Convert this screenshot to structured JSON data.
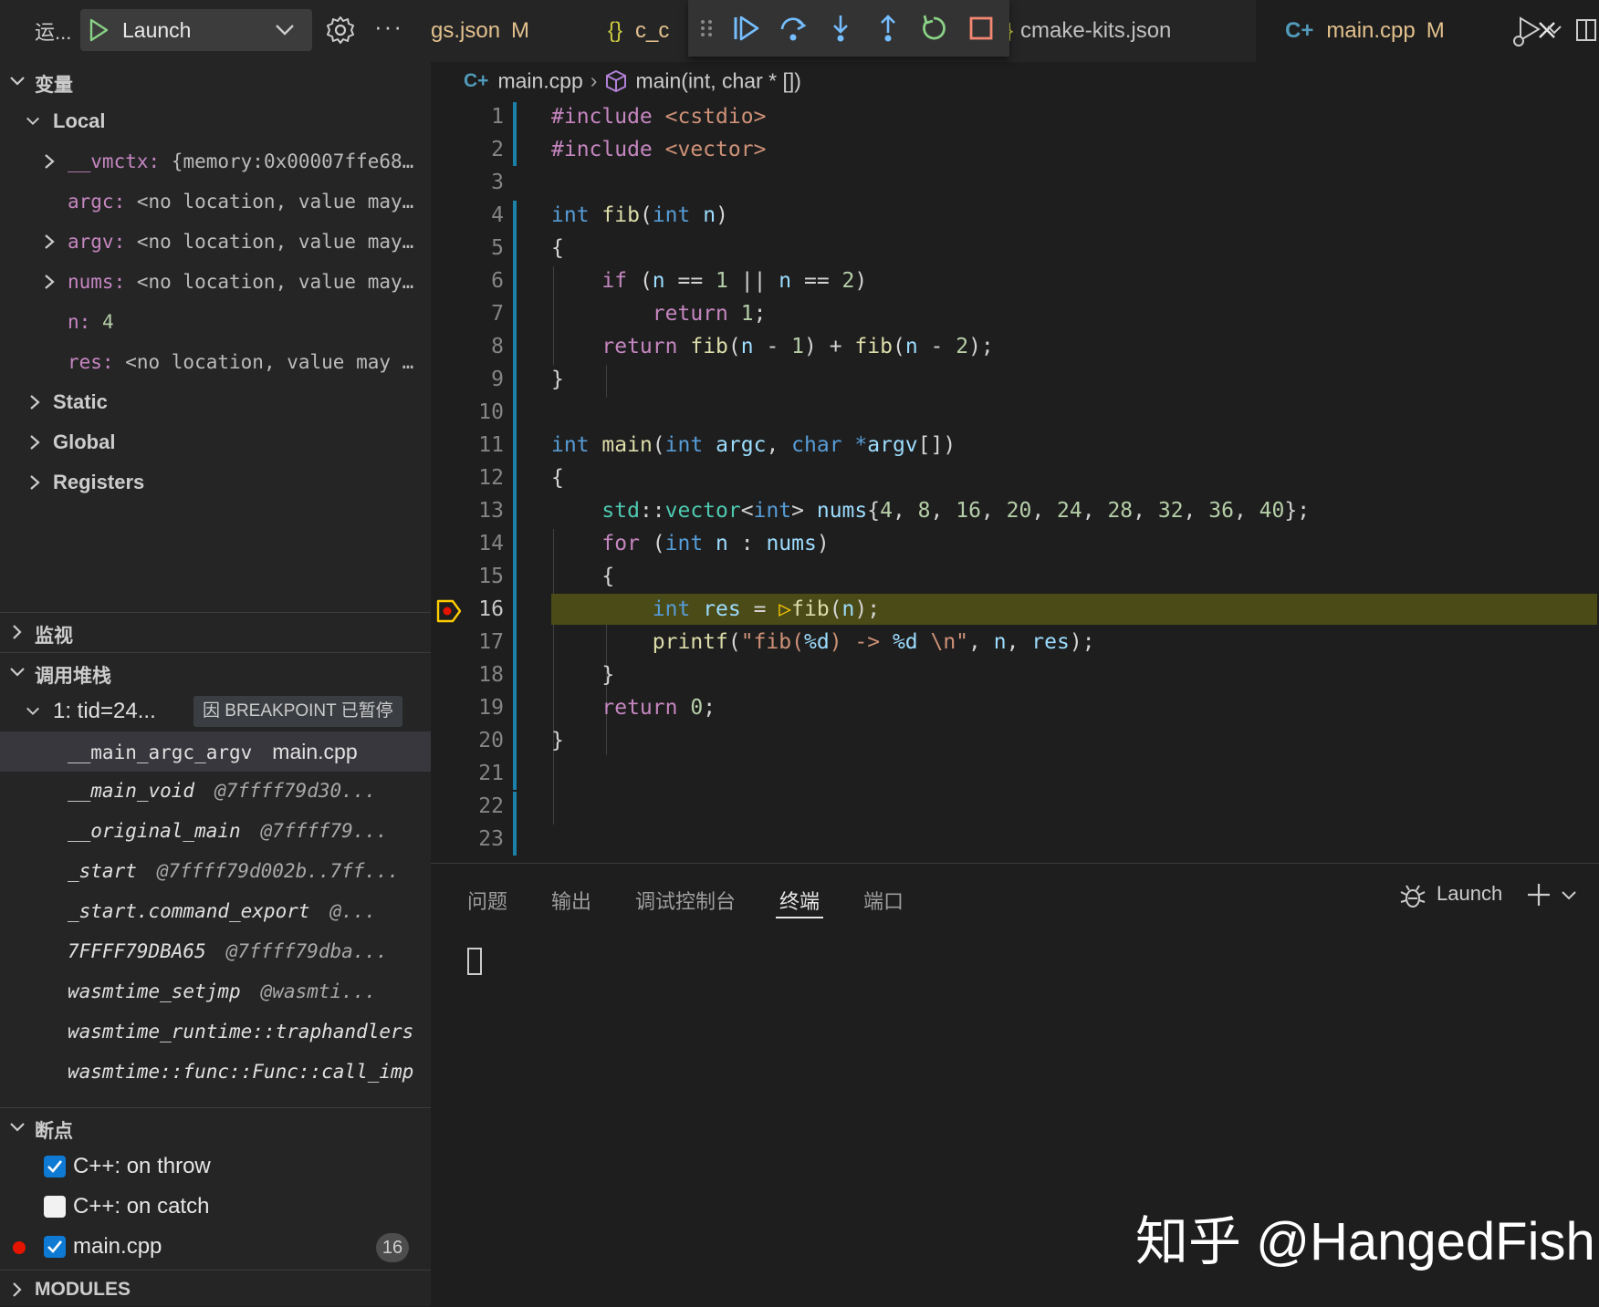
{
  "run_panel": {
    "title": "运...",
    "config": "Launch"
  },
  "sections": {
    "variables": "变量",
    "watch": "监视",
    "call_stack": "调用堆栈",
    "breakpoints": "断点",
    "modules": "MODULES"
  },
  "scopes": {
    "local": "Local",
    "static": "Static",
    "global": "Global",
    "registers": "Registers"
  },
  "variables": [
    {
      "name": "__vmctx:",
      "value": " {memory:0x00007ffe68…"
    },
    {
      "name": "argc:",
      "value": " <no location, value may…"
    },
    {
      "name": "argv:",
      "value": " <no location, value may…"
    },
    {
      "name": "nums:",
      "value": " <no location, value may…"
    },
    {
      "name": "n:",
      "value": " 4"
    },
    {
      "name": "res:",
      "value": " <no location, value may …"
    }
  ],
  "call_stack": {
    "thread": "1: tid=24...",
    "status": "因 BREAKPOINT 已暂停",
    "frames": [
      {
        "name": "__main_argc_argv",
        "loc": "main.cpp"
      },
      {
        "name": "__main_void",
        "loc": "@7ffff79d30..."
      },
      {
        "name": "__original_main",
        "loc": "@7ffff79..."
      },
      {
        "name": "_start",
        "loc": "@7ffff79d002b..7ff..."
      },
      {
        "name": "_start.command_export",
        "loc": "@..."
      },
      {
        "name": "7FFFF79DBA65",
        "loc": "@7ffff79dba..."
      },
      {
        "name": "wasmtime_setjmp",
        "loc": "@wasmti..."
      },
      {
        "name": "wasmtime_runtime::traphandlers",
        "loc": ""
      },
      {
        "name": "wasmtime::func::Func::call_imp",
        "loc": ""
      }
    ]
  },
  "breakpoints": [
    {
      "label": "C++: on throw",
      "checked": true
    },
    {
      "label": "C++: on catch",
      "checked": false
    },
    {
      "label": "main.cpp",
      "checked": true,
      "line": "16"
    }
  ],
  "tabs": [
    {
      "label": "gs.json",
      "modified": "M"
    },
    {
      "label": "c_c"
    },
    {
      "label": "cmake-kits.json"
    },
    {
      "label": "main.cpp",
      "modified": "M"
    }
  ],
  "breadcrumb": {
    "file": "main.cpp",
    "symbol": "main(int, char * [])"
  },
  "editor": {
    "current_line": 16
  },
  "panel": {
    "tabs": [
      "问题",
      "输出",
      "调试控制台",
      "终端",
      "端口"
    ],
    "active_tab": "终端",
    "terminal_profile": "Launch"
  },
  "watermark": "知乎 @HangedFish"
}
